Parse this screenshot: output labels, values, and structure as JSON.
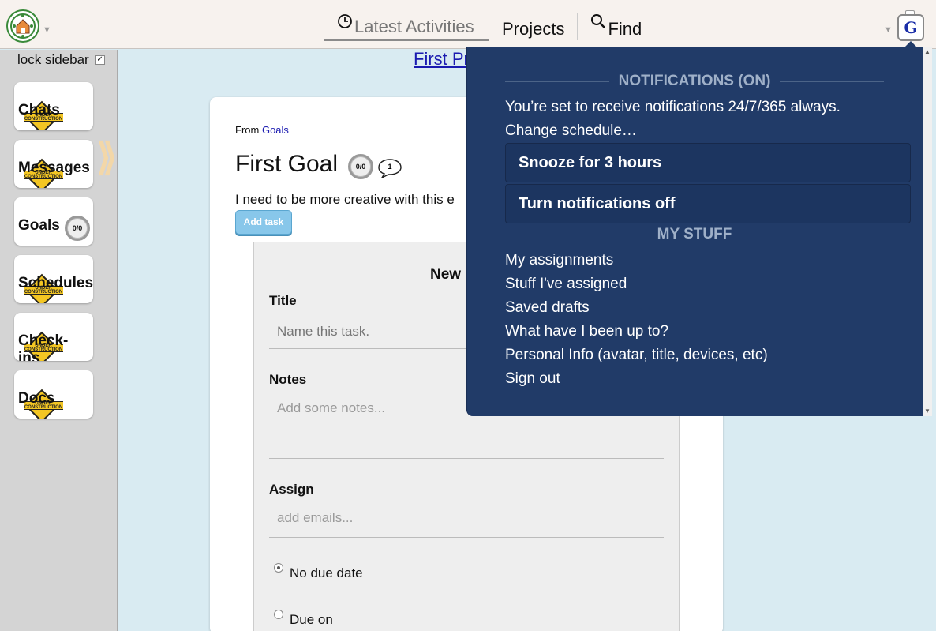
{
  "topbar": {
    "nav": [
      {
        "label": "Latest Activities",
        "icon": "clock-icon",
        "active": true
      },
      {
        "label": "Projects"
      },
      {
        "label": "Find",
        "icon": "search-icon"
      }
    ],
    "avatar_letter": "G"
  },
  "sidebar": {
    "lock_label": "lock sidebar",
    "lock_checked": "✓",
    "items": [
      {
        "label": "Chats",
        "under_construction": true
      },
      {
        "label": "Messages",
        "under_construction": true
      },
      {
        "label": "Goals",
        "badge": "0/0"
      },
      {
        "label": "Schedules",
        "under_construction": true
      },
      {
        "label": "Check-ins",
        "under_construction": true
      },
      {
        "label": "Docs",
        "under_construction": true
      }
    ],
    "under_construction_text": "UNDER CONSTRUCTION"
  },
  "main": {
    "project_link": "First Project",
    "from_label": "From",
    "from_link": "Goals",
    "goal_title": "First Goal",
    "goal_badge": "0/0",
    "comment_count": "1",
    "description": "I need to be more creative with this e",
    "add_task_label": "Add task",
    "new_task": {
      "heading": "New",
      "title_label": "Title",
      "title_placeholder": "Name this task.",
      "notes_label": "Notes",
      "notes_placeholder": "Add some notes...",
      "assign_label": "Assign",
      "assign_placeholder": "add emails...",
      "due_options": [
        {
          "label": "No due date",
          "selected": true
        },
        {
          "label": "Due on",
          "selected": false
        }
      ]
    }
  },
  "dropdown": {
    "notifications_heading": "NOTIFICATIONS (ON)",
    "notifications_text": "You’re set to receive notifications 24/7/365 always.",
    "change_schedule": "Change schedule…",
    "snooze_label": "Snooze for 3 hours",
    "turn_off_label": "Turn notifications off",
    "mystuff_heading": "MY STUFF",
    "mystuff_items": [
      "My assignments",
      "Stuff I've assigned",
      "Saved drafts",
      "What have I been up to?",
      "Personal Info (avatar, title, devices, etc)",
      "Sign out"
    ]
  },
  "colors": {
    "dropdown_bg": "#213b68",
    "sidebar_bg": "#d4d4d4",
    "main_bg": "#d9ebf2",
    "accent_button": "#88c7ea"
  }
}
